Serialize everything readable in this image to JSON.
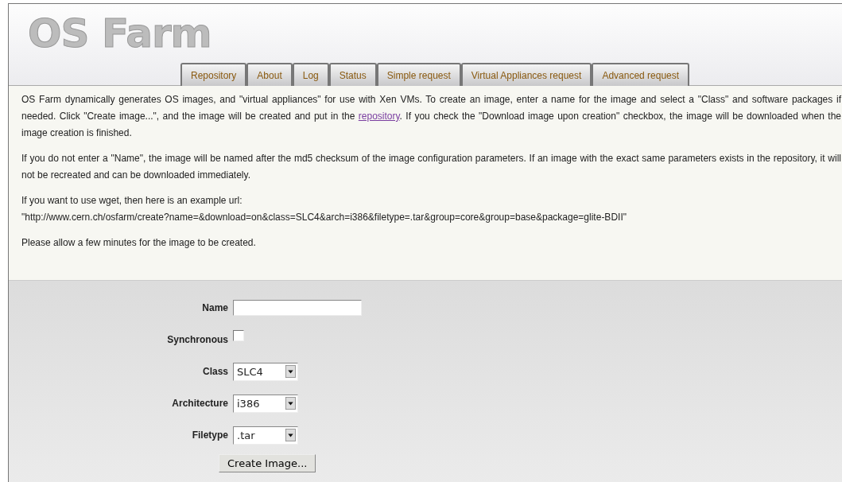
{
  "logo": "OS Farm",
  "tabs": [
    {
      "label": "Repository",
      "selected": false
    },
    {
      "label": "About",
      "selected": false
    },
    {
      "label": "Log",
      "selected": false
    },
    {
      "label": "Status",
      "selected": false
    },
    {
      "label": "Simple request",
      "selected": false
    },
    {
      "label": "Virtual Appliances request",
      "selected": false
    },
    {
      "label": "Advanced request",
      "selected": false
    }
  ],
  "intro": {
    "text_before": "OS Farm dynamically generates OS images, and \"virtual appliances\" for use with Xen VMs. To create an image, enter a name for the image and select a \"Class\" and software packages if needed. Click \"Create image...\", and the image will be created and put in the",
    "link": "repository",
    "text_after": ". If you check the \"Download image upon creation\" checkbox, the image will be downloaded when the image creation is finished."
  },
  "paragraphs": [
    "If you do not enter a \"Name\", the image will be named after the md5 checksum of the image configuration parameters. If an image with the exact same parameters exists in the repository, it will not be recreated and can be downloaded immediately."
  ],
  "wget": {
    "text": "If you want to use wget, then here is an example url:",
    "url": "\"http://www.cern.ch/osfarm/create?name=&download=on&class=SLC4&arch=i386&filetype=.tar&group=core&group=base&package=glite-BDII\""
  },
  "note": "Please allow a few minutes for the image to be created.",
  "form": [
    {
      "kind": "text",
      "label": "Name"
    },
    {
      "kind": "checkbox",
      "label": "Synchronous",
      "checked": false
    },
    {
      "kind": "select",
      "label": "Class",
      "value": "SLC4"
    },
    {
      "kind": "select",
      "label": "Architecture",
      "value": "i386"
    },
    {
      "kind": "select",
      "label": "Filetype",
      "value": ".tar"
    }
  ],
  "submit": "Create Image..."
}
